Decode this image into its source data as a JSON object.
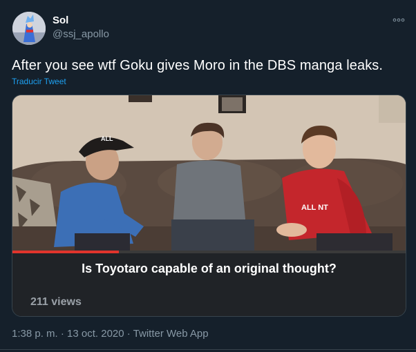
{
  "author": {
    "name": "Sol",
    "handle": "@ssj_apollo"
  },
  "tweet": {
    "text": "After you see wtf Goku gives Moro in the DBS manga leaks.",
    "translate_label": "Traducir Tweet"
  },
  "video": {
    "caption": "Is Toyotaro capable of an original thought?",
    "views": "211 views",
    "progress": 0.27,
    "cap_text": "ALL",
    "shirt_text": "ALL NT"
  },
  "meta": {
    "timestamp": "1:38 p. m. · 13 oct. 2020 · Twitter Web App"
  },
  "colors": {
    "background": "#15202b",
    "link": "#1da1f2",
    "secondary_text": "#8899a6",
    "progress_red": "#e0342c"
  },
  "icons": {
    "more": "more-horizontal-icon"
  }
}
